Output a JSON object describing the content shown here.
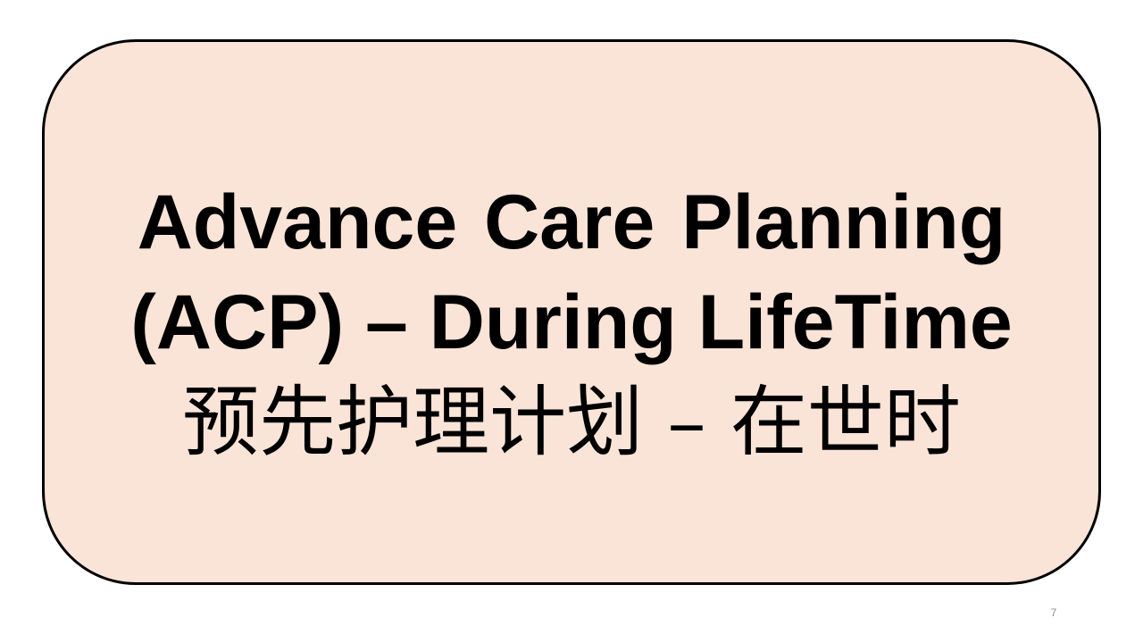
{
  "slide": {
    "title_line_1": "Advance Care Planning",
    "title_line_2": "(ACP) – During LifeTime",
    "title_line_3": "预先护理计划 – 在世时",
    "page_number": "7"
  },
  "colors": {
    "box_fill": "#fae4d8",
    "box_border": "#000000",
    "text": "#000000",
    "page_number": "#8c8c8c",
    "background": "#ffffff"
  }
}
